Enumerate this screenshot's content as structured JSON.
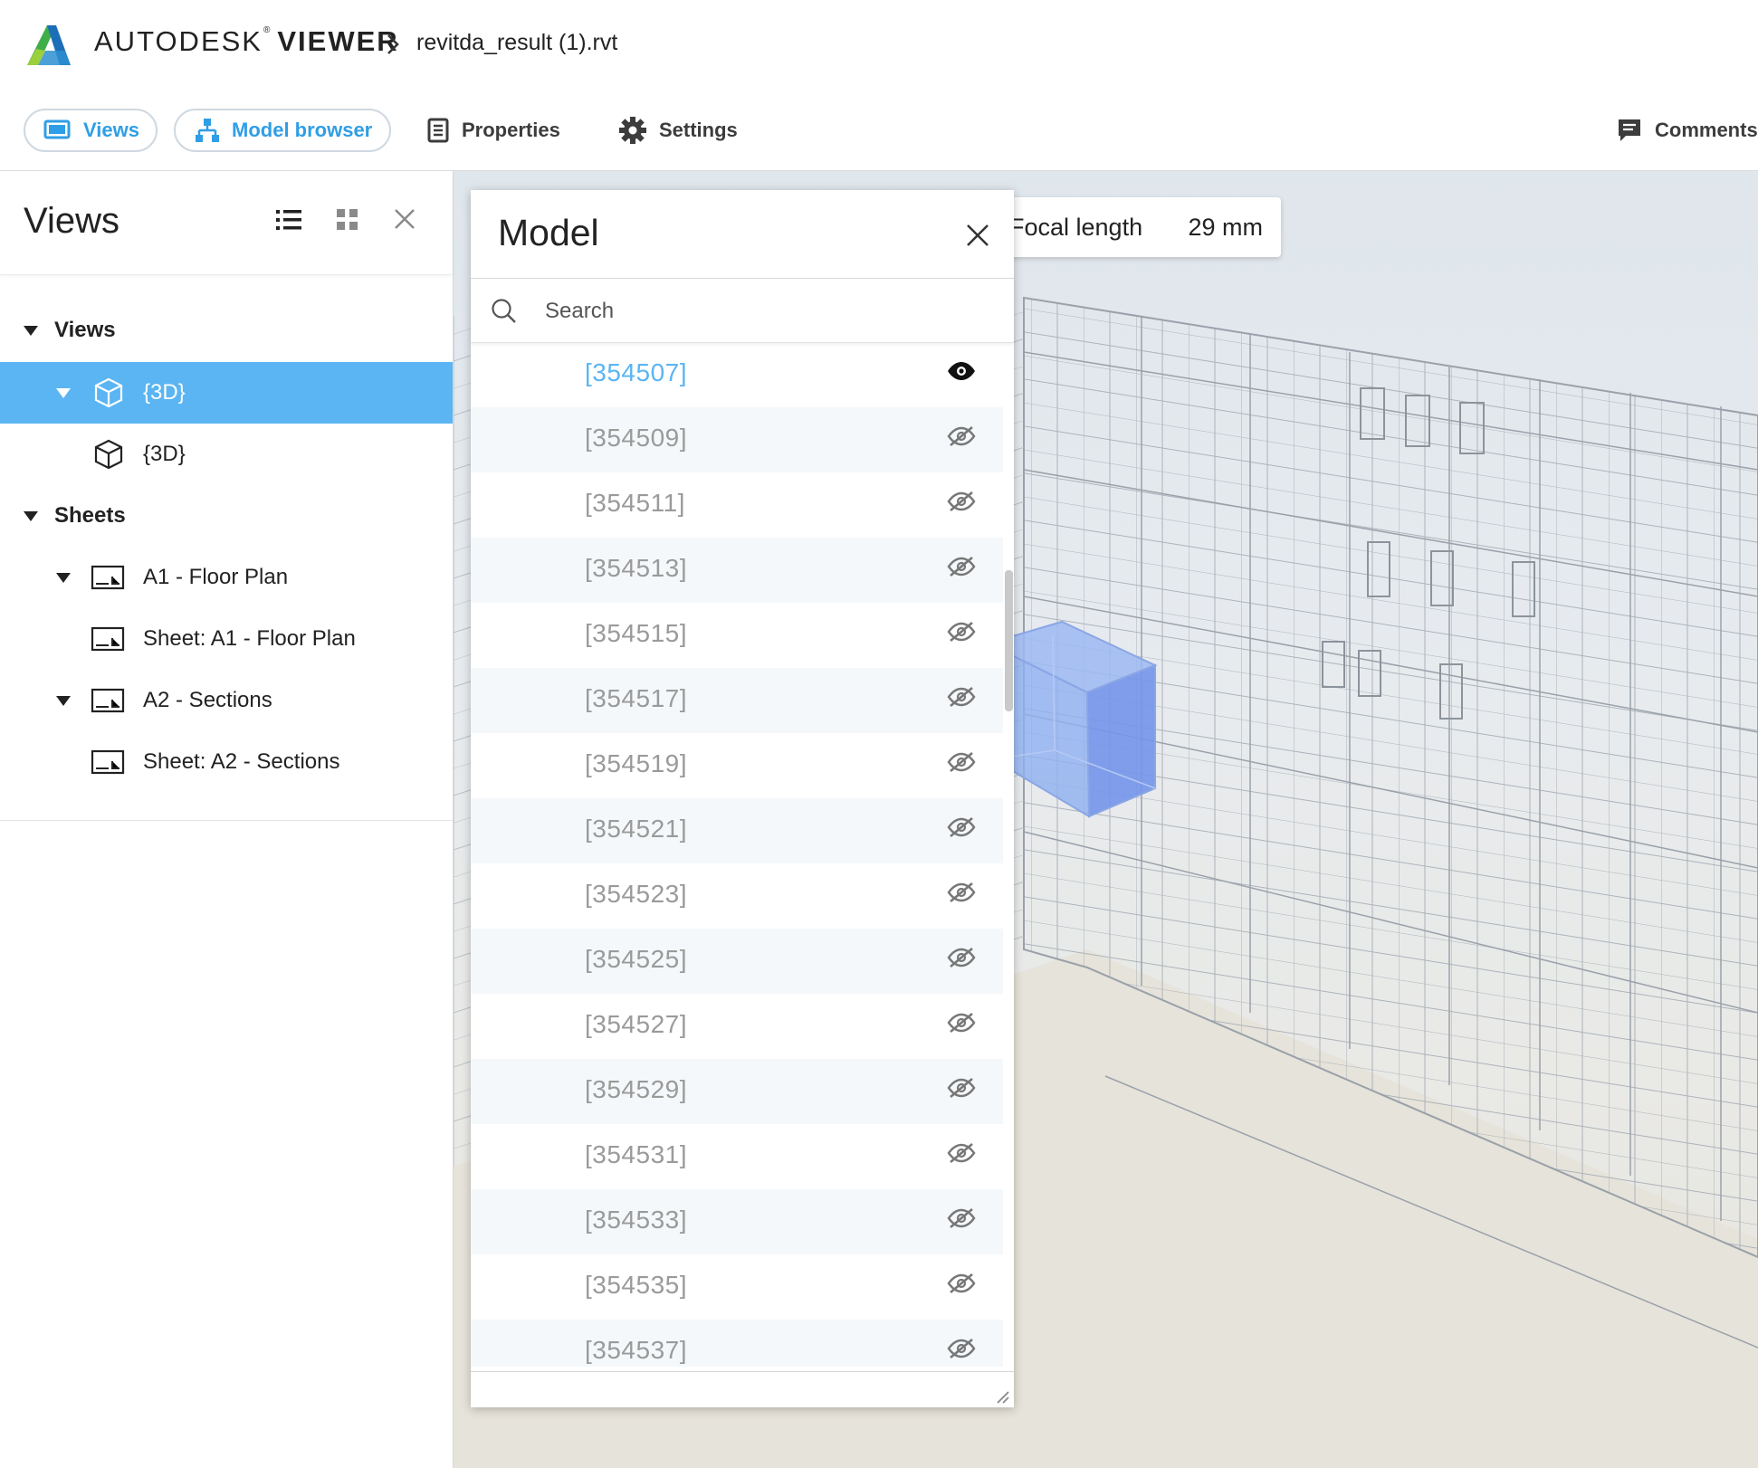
{
  "header": {
    "brand": "AUTODESK",
    "brand_mark": "®",
    "product": "VIEWER",
    "filename": "revitda_result (1).rvt"
  },
  "toolbar": {
    "views": "Views",
    "model_browser": "Model browser",
    "properties": "Properties",
    "settings": "Settings",
    "comments": "Comments"
  },
  "views_panel": {
    "title": "Views",
    "tree": [
      {
        "label": "Views",
        "kind": "group"
      },
      {
        "label": "{3D}",
        "kind": "view-3d",
        "selected": true
      },
      {
        "label": "{3D}",
        "kind": "view-3d"
      },
      {
        "label": "Sheets",
        "kind": "group"
      },
      {
        "label": "A1 - Floor Plan",
        "kind": "sheet"
      },
      {
        "label": "Sheet: A1 - Floor Plan",
        "kind": "sheet"
      },
      {
        "label": "A2 - Sections",
        "kind": "sheet"
      },
      {
        "label": "Sheet: A2 - Sections",
        "kind": "sheet"
      }
    ]
  },
  "focal": {
    "label": "Focal length",
    "value": "29 mm"
  },
  "model_panel": {
    "title": "Model",
    "search_placeholder": "Search",
    "items": [
      {
        "label": "[354507]",
        "visible": true
      },
      {
        "label": "[354509]",
        "visible": false
      },
      {
        "label": "[354511]",
        "visible": false
      },
      {
        "label": "[354513]",
        "visible": false
      },
      {
        "label": "[354515]",
        "visible": false
      },
      {
        "label": "[354517]",
        "visible": false
      },
      {
        "label": "[354519]",
        "visible": false
      },
      {
        "label": "[354521]",
        "visible": false
      },
      {
        "label": "[354523]",
        "visible": false
      },
      {
        "label": "[354525]",
        "visible": false
      },
      {
        "label": "[354527]",
        "visible": false
      },
      {
        "label": "[354529]",
        "visible": false
      },
      {
        "label": "[354531]",
        "visible": false
      },
      {
        "label": "[354533]",
        "visible": false
      },
      {
        "label": "[354535]",
        "visible": false
      },
      {
        "label": "[354537]",
        "visible": false
      }
    ]
  },
  "colors": {
    "accent": "#5ab5f2",
    "link": "#2f9ee6",
    "selection_box": "#7fa5ee"
  }
}
